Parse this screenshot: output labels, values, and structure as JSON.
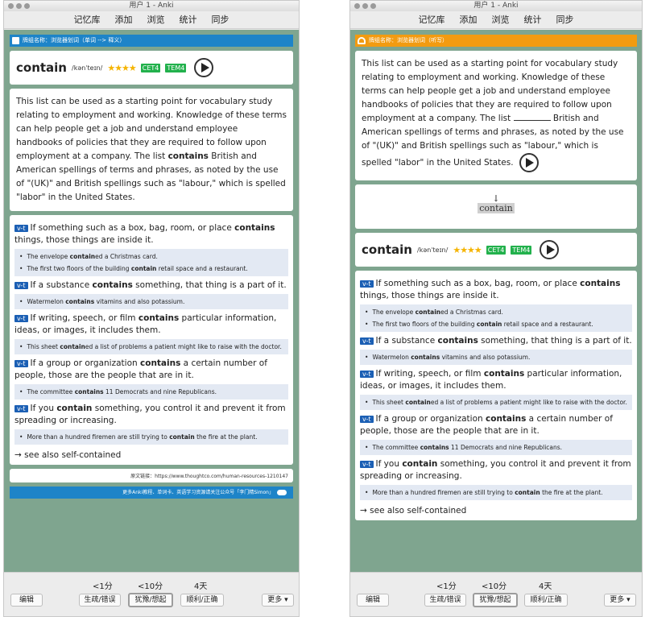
{
  "window": {
    "title": "用户 1 - Anki"
  },
  "toolbar": {
    "decks": "记忆库",
    "add": "添加",
    "browse": "浏览",
    "stats": "统计",
    "sync": "同步"
  },
  "left": {
    "deck_label": "牌组名称：浏览器划词（单词 --> 释义）",
    "source": "原文链接：https://www.thoughtco.com/human-resources-1210147",
    "footer": "更多Anki教程、单词卡、英语学习资源请关注公众号「李门精Simon」"
  },
  "right": {
    "deck_label": "牌组名称：浏览器划词（听写）",
    "arrow": "↓",
    "headword": "contain"
  },
  "word": {
    "text": "contain",
    "ipa": "/kənˈteɪn/",
    "stars": "★★★★",
    "tag1": "CET4",
    "tag2": "TEM4"
  },
  "passage": {
    "p1": "This list can be used as a starting point for vocabulary study relating to employment and working. Knowledge of these terms can help people get a job and understand employee handbooks of policies that they are required to follow upon employment at a company. The list ",
    "key": "contains",
    "p2": " British and American spellings of terms and phrases, as noted by the use of \"(UK)\" and British spellings such as \"labour,\" which is spelled \"labor\" in the United States.",
    "r1": "This list can be used as a starting point for vocabulary study relating to employment and working. Knowledge of these terms can help people get a job and understand employee handbooks of policies that they are required to follow upon employment at a company. The list ",
    "r2": " British and American spellings of terms and phrases, as noted by the use of \"(UK)\" and British spellings such as \"labour,\" which is spelled \"labor\" in the United States."
  },
  "senses": [
    {
      "pos": "v-t",
      "a": "If something such as a box, bag, room, or place ",
      "b": "contains",
      "c": " things, those things are inside it."
    },
    {
      "pos": "v-t",
      "a": "If a substance ",
      "b": "contains",
      "c": " something, that thing is a part of it."
    },
    {
      "pos": "v-t",
      "a": "If writing, speech, or film ",
      "b": "contains",
      "c": " particular information, ideas, or images, it includes them."
    },
    {
      "pos": "v-t",
      "a": "If a group or organization ",
      "b": "contains",
      "c": " a certain number of people, those are the people that are in it."
    },
    {
      "pos": "v-t",
      "a": "If you ",
      "b": "contain",
      "c": " something, you control it and prevent it from spreading or increasing."
    }
  ],
  "examples": {
    "e1a": "The envelope ",
    "e1b": "contain",
    "e1c": "ed a Christmas card.",
    "e2a": "The first two floors of the building ",
    "e2b": "contain",
    "e2c": " retail space and a restaurant.",
    "e3a": "Watermelon ",
    "e3b": "contains",
    "e3c": " vitamins and also potassium.",
    "e4a": "This sheet ",
    "e4b": "contain",
    "e4c": "ed a list of problems a patient might like to raise with the doctor.",
    "e5a": "The committee ",
    "e5b": "contains",
    "e5c": " 11 Democrats and nine Republicans.",
    "e6a": "More than a hundred firemen are still trying to ",
    "e6b": "contain",
    "e6c": " the fire at the plant."
  },
  "see_also": "→ see also self-contained",
  "answer": {
    "t1": "<1分",
    "t2": "<10分",
    "t3": "4天",
    "edit": "编辑",
    "again": "生疏/错误",
    "hard": "犹豫/想起",
    "good": "顺利/正确",
    "more": "更多 ▾"
  }
}
